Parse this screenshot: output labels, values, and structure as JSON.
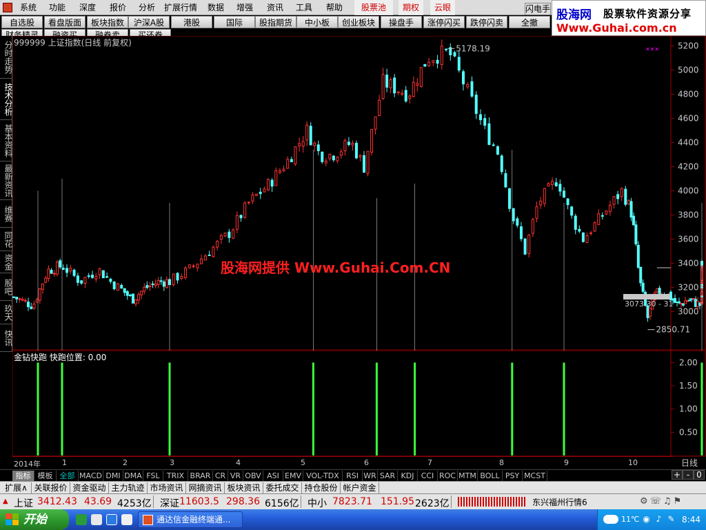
{
  "menu": {
    "items": [
      "系统",
      "功能",
      "深度",
      "报价",
      "分析",
      "扩展行情",
      "数据",
      "增强",
      "资讯",
      "工具",
      "帮助"
    ],
    "special": [
      "股票池",
      "期权",
      "云眼"
    ]
  },
  "toolbar": {
    "row1": [
      "自选股",
      "看盘版面",
      "板块指数",
      "沪深A股",
      "港股",
      "国际",
      "股指期货",
      "中小板",
      "创业板块",
      "操盘手",
      "涨停闪买",
      "跌停闪卖",
      "全撤"
    ],
    "row2": [
      "财务精灵",
      "融资买",
      "融券卖",
      "买还券"
    ]
  },
  "banner": {
    "flash_label": "闪电手",
    "logo": "股海网",
    "slogan": "股票软件资源分享",
    "url": "Www.Guhai.com.cn"
  },
  "left_tabs": [
    "分时走势",
    "技术分析",
    "基本资料",
    "最新资讯",
    "维赛",
    "同花",
    "资金",
    "股吧",
    "玖天",
    "快讯"
  ],
  "main_chart": {
    "title": "999999 上证指数(日线 前复权)",
    "high_label": "5178.19",
    "low_label": "2850.71",
    "last_label": "3073.30 - 31",
    "watermark": "股海网提供 Www.Guhai.Com.CN"
  },
  "sub_chart": {
    "title": "金钻快跑  快跑位置: 0.00"
  },
  "date_axis": {
    "labels": [
      "2014年",
      "1",
      "2",
      "3",
      "4",
      "5",
      "6",
      "7",
      "8",
      "9",
      "10"
    ],
    "period": "日线"
  },
  "indicator_tabs": [
    "指标",
    "模板",
    "全部",
    "MACD",
    "DMI",
    "DMA",
    "FSL",
    "TRIX",
    "BRAR",
    "CR",
    "VR",
    "OBV",
    "ASI",
    "EMV",
    "VOL-TDX",
    "RSI",
    "WR",
    "SAR",
    "KDJ",
    "CCI",
    "ROC",
    "MTM",
    "BOLL",
    "PSY",
    "MCST"
  ],
  "zoom_buttons": [
    "+",
    "-",
    "0"
  ],
  "info_tabs": [
    "扩展∧",
    "关联报价",
    "资金驱动",
    "主力轨迹",
    "市场资讯",
    "网摘资讯",
    "板块资讯",
    "委托成交",
    "持仓股份",
    "帐户资金"
  ],
  "quotes": [
    {
      "name": "上证",
      "price": "3412.43",
      "change": "43.69",
      "amount": "4253亿"
    },
    {
      "name": "深证",
      "price": "11603.5",
      "change": "298.36",
      "amount": "6156亿"
    },
    {
      "name": "中小",
      "price": "7823.71",
      "change": "151.95",
      "amount": "2623亿"
    }
  ],
  "status_text": "东兴福州行情6",
  "taskbar": {
    "start_label": "开始",
    "task_label": "通达信金融终端通...",
    "temperature": "11℃",
    "clock": "8:44"
  },
  "chart_data": {
    "type": "candlestick",
    "title": "999999 上证指数(日线 前复权)",
    "x_labels": [
      "2014年",
      "1",
      "2",
      "3",
      "4",
      "5",
      "6",
      "7",
      "8",
      "9",
      "10"
    ],
    "y_ticks": [
      3000,
      3200,
      3400,
      3600,
      3800,
      4000,
      4200,
      4400,
      4600,
      4800,
      5000,
      5200
    ],
    "ylim": [
      2700,
      5260
    ],
    "annotations": {
      "high": 5178.19,
      "low": 2850.71
    },
    "close_path": [
      {
        "m": 0.0,
        "v": 3120
      },
      {
        "m": 0.4,
        "v": 3050
      },
      {
        "m": 0.7,
        "v": 3340
      },
      {
        "m": 1.0,
        "v": 3380
      },
      {
        "m": 1.3,
        "v": 3250
      },
      {
        "m": 1.6,
        "v": 3350
      },
      {
        "m": 1.8,
        "v": 3250
      },
      {
        "m": 2.2,
        "v": 3100
      },
      {
        "m": 2.5,
        "v": 3200
      },
      {
        "m": 2.8,
        "v": 3250
      },
      {
        "m": 3.0,
        "v": 3250
      },
      {
        "m": 3.3,
        "v": 3350
      },
      {
        "m": 3.6,
        "v": 3500
      },
      {
        "m": 3.9,
        "v": 3650
      },
      {
        "m": 4.2,
        "v": 3900
      },
      {
        "m": 4.5,
        "v": 4050
      },
      {
        "m": 4.8,
        "v": 4250
      },
      {
        "m": 5.1,
        "v": 4500
      },
      {
        "m": 5.3,
        "v": 4300
      },
      {
        "m": 5.5,
        "v": 4300
      },
      {
        "m": 5.8,
        "v": 4400
      },
      {
        "m": 6.0,
        "v": 4200
      },
      {
        "m": 6.3,
        "v": 4900
      },
      {
        "m": 6.7,
        "v": 4800
      },
      {
        "m": 7.0,
        "v": 5100
      },
      {
        "m": 7.3,
        "v": 5150
      },
      {
        "m": 7.5,
        "v": 4900
      },
      {
        "m": 7.8,
        "v": 4500
      },
      {
        "m": 8.0,
        "v": 4300
      },
      {
        "m": 8.2,
        "v": 3800
      },
      {
        "m": 8.4,
        "v": 3500
      },
      {
        "m": 8.6,
        "v": 3900
      },
      {
        "m": 8.9,
        "v": 4100
      },
      {
        "m": 9.1,
        "v": 3800
      },
      {
        "m": 9.3,
        "v": 3600
      },
      {
        "m": 9.6,
        "v": 3800
      },
      {
        "m": 9.9,
        "v": 4000
      },
      {
        "m": 10.1,
        "v": 3800
      },
      {
        "m": 10.3,
        "v": 3250
      },
      {
        "m": 10.5,
        "v": 2950
      },
      {
        "m": 10.7,
        "v": 3150
      },
      {
        "m": 11.0,
        "v": 3150
      },
      {
        "m": 11.3,
        "v": 3050
      },
      {
        "m": 11.6,
        "v": 3100
      },
      {
        "m": 12.0,
        "v": 3050
      },
      {
        "m": 12.3,
        "v": 3200
      },
      {
        "m": 12.6,
        "v": 3300
      },
      {
        "m": 12.9,
        "v": 3400
      }
    ],
    "signals": {
      "name": "金钻快跑",
      "y_ticks": [
        0.5,
        1.0,
        1.5,
        2.0
      ],
      "ylim": [
        0,
        2.2
      ],
      "positions_month": [
        0.5,
        1.0,
        3.0,
        5.2,
        6.2,
        6.8,
        8.2,
        9.0,
        12.0
      ],
      "value": 2.0
    }
  }
}
